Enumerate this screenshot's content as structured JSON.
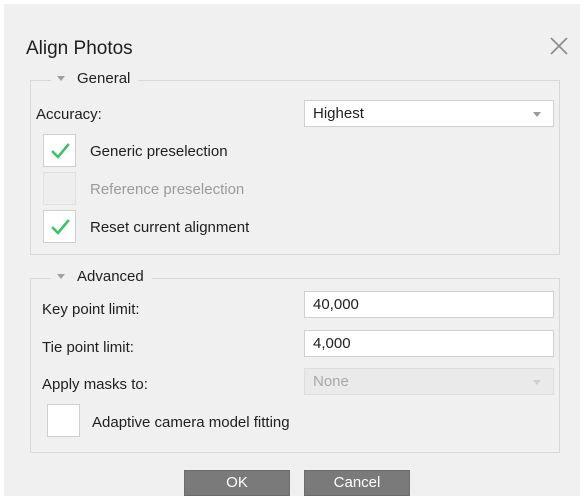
{
  "dialog": {
    "title": "Align Photos",
    "close_icon": "close-icon"
  },
  "general": {
    "legend": "General",
    "accuracy_label": "Accuracy:",
    "accuracy_value": "Highest",
    "generic_preselection": {
      "label": "Generic preselection",
      "checked": true,
      "enabled": true
    },
    "reference_preselection": {
      "label": "Reference preselection",
      "checked": false,
      "enabled": false
    },
    "reset_alignment": {
      "label": "Reset current alignment",
      "checked": true,
      "enabled": true
    }
  },
  "advanced": {
    "legend": "Advanced",
    "key_point_label": "Key point limit:",
    "key_point_value": "40,000",
    "tie_point_label": "Tie point limit:",
    "tie_point_value": "4,000",
    "masks_label": "Apply masks to:",
    "masks_value": "None",
    "adaptive_fitting": {
      "label": "Adaptive camera model fitting",
      "checked": false,
      "enabled": true
    }
  },
  "buttons": {
    "ok": "OK",
    "cancel": "Cancel"
  },
  "colors": {
    "check": "#3cc36a",
    "background": "#f0f0f0",
    "button": "#7a7a7a"
  }
}
